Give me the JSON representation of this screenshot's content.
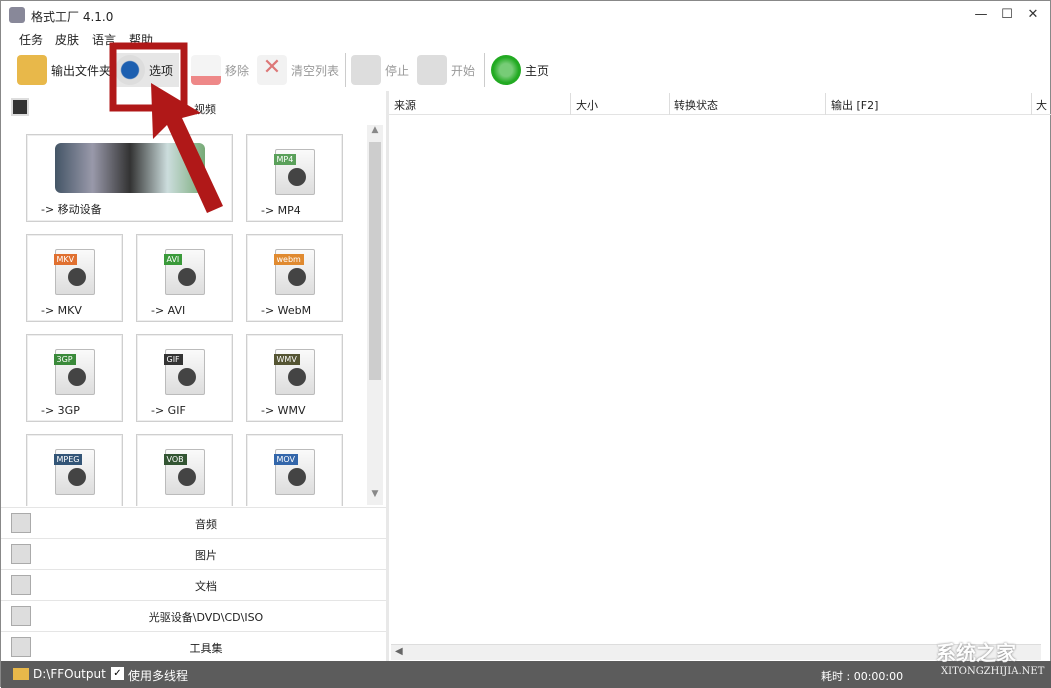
{
  "window": {
    "title": "格式工厂 4.1.0",
    "controls": [
      "minimize",
      "maximize",
      "close"
    ]
  },
  "menu": [
    "任务",
    "皮肤",
    "语言",
    "帮助"
  ],
  "toolbar": [
    {
      "label": "输出文件夹",
      "icon": "folder-icon",
      "enabled": true
    },
    {
      "label": "选项",
      "icon": "gear-icon",
      "enabled": true
    },
    {
      "label": "移除",
      "icon": "remove-icon",
      "enabled": false
    },
    {
      "label": "清空列表",
      "icon": "clear-list-icon",
      "enabled": false
    },
    {
      "label": "停止",
      "icon": "stop-icon",
      "enabled": false
    },
    {
      "label": "开始",
      "icon": "start-icon",
      "enabled": false
    },
    {
      "label": "主页",
      "icon": "globe-search-icon",
      "enabled": true
    }
  ],
  "left": {
    "section": "视频",
    "tiles": [
      {
        "label": "-> 移动设备",
        "badge": ""
      },
      {
        "label": "-> MP4",
        "badge": "MP4",
        "color": "#5aa05a"
      },
      {
        "label": "-> MKV",
        "badge": "MKV",
        "color": "#e07030"
      },
      {
        "label": "-> AVI",
        "badge": "AVI",
        "color": "#3a9a3a"
      },
      {
        "label": "-> WebM",
        "badge": "webm",
        "color": "#e08a30"
      },
      {
        "label": "-> 3GP",
        "badge": "3GP",
        "color": "#3a8a3a"
      },
      {
        "label": "-> GIF",
        "badge": "GIF",
        "color": "#333333"
      },
      {
        "label": "-> WMV",
        "badge": "WMV",
        "color": "#555533"
      },
      {
        "label": "",
        "badge": "MPEG",
        "color": "#335577"
      },
      {
        "label": "",
        "badge": "VOB",
        "color": "#335533"
      },
      {
        "label": "",
        "badge": "MOV",
        "color": "#3366aa"
      }
    ],
    "categories": [
      {
        "label": "音频",
        "icon": "music-icon"
      },
      {
        "label": "图片",
        "icon": "picture-icon"
      },
      {
        "label": "文档",
        "icon": "document-icon"
      },
      {
        "label": "光驱设备\\DVD\\CD\\ISO",
        "icon": "disc-drive-icon"
      },
      {
        "label": "工具集",
        "icon": "tools-icon"
      }
    ]
  },
  "table": {
    "columns": [
      "来源",
      "大小",
      "转换状态",
      "输出 [F2]",
      "大"
    ]
  },
  "status": {
    "output_folder": "D:\\FFOutput",
    "multithread_label": "使用多线程",
    "multithread_checked": true,
    "elapsed": "耗时 : 00:00:00"
  },
  "watermark": {
    "text": "系统之家",
    "url": "XITONGZHIJIA.NET"
  },
  "annotation_color": "#b01818"
}
